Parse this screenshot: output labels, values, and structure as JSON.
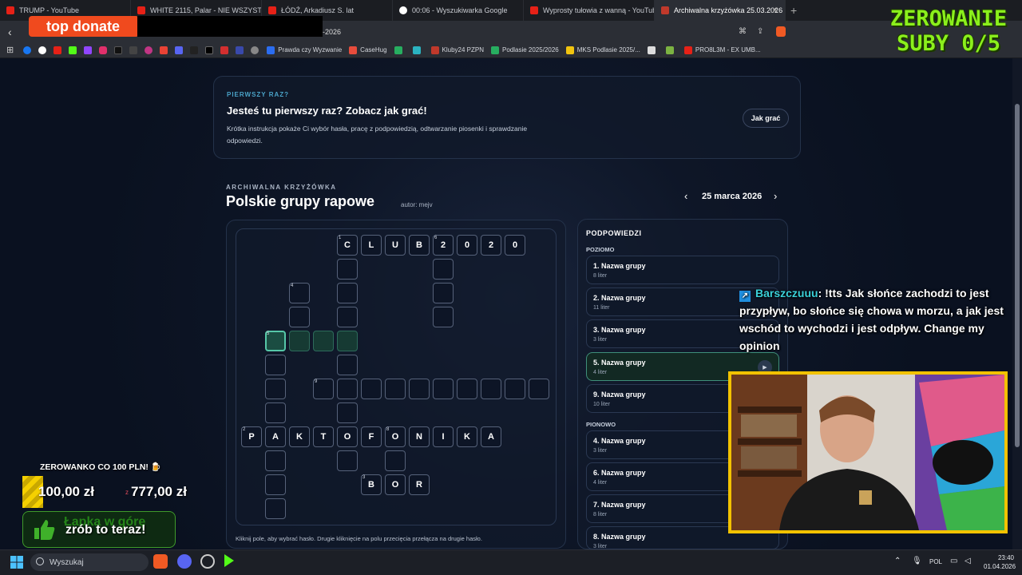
{
  "browser": {
    "tabs": [
      {
        "title": "TRUMP - YouTube",
        "color": "#e62117"
      },
      {
        "title": "WHITE 2115, Palar - NIE WSZYSTKO",
        "color": "#e62117"
      },
      {
        "title": "ŁÓDŹ, Arkadiusz S. lat",
        "color": "#e62117"
      },
      {
        "title": "00:06 - Wyszukiwarka Google",
        "color": "#4285f4"
      },
      {
        "title": "Wyprosty tułowia z wanną - YouTube",
        "color": "#e62117"
      },
      {
        "title": "Archiwalna krzyżówka 25.03.2026",
        "color": "#c0392b"
      }
    ],
    "address_tail": "-2026",
    "bookmarks": [
      "Prawda czy Wyzwanie",
      "CaseHug",
      "Kluby24 PZPN",
      "Podlasie 2025/2026",
      "MKS Podlasie 2025/...",
      "PRO8L3M - EX UMB..."
    ],
    "bookmark_colors": [
      "#2b6df0",
      "#e74c3c",
      "#27ae60",
      "#27ae60",
      "#f1c40f",
      "#e62117"
    ]
  },
  "overlays": {
    "top_donate": "top donate",
    "zerowanie_line1": "ZEROWANIE",
    "zerowanie_line2": "SUBY 0/5",
    "zerowanko": "ZEROWANKO CO 100 PLN! 🍺",
    "goal_current": "100,00 zł",
    "goal_sep": "z",
    "goal_max": "777,00 zł",
    "goal_progress": 0.129,
    "cta_line1": "Łapka w górę",
    "cta_line2": "zrób to teraz!"
  },
  "chat": {
    "user": "Barszczuuu",
    "message": ": !tts Jak słońce zachodzi to jest przypływ, bo słońce się chowa w morzu, a jak jest wschód to wychodzi i jest odpływ. Change my opinion"
  },
  "intro": {
    "kicker": "PIERWSZY RAZ?",
    "heading": "Jesteś tu pierwszy raz? Zobacz jak grać!",
    "text": "Krótka instrukcja pokaże Ci wybór hasła, pracę z podpowiedzią, odtwarzanie piosenki i sprawdzanie odpowiedzi.",
    "button": "Jak grać"
  },
  "puzzle": {
    "kicker": "ARCHIWALNA KRZYŻÓWKA",
    "title": "Polskie grupy rapowe",
    "author": "autor: mejv",
    "date": "25 marca 2026",
    "hint": "Kliknij pole, aby wybrać hasło. Drugie kliknięcie na polu przecięcia przełącza na drugie hasło."
  },
  "clues": {
    "heading": "PODPOWIEDZI",
    "across_label": "POZIOMO",
    "down_label": "PIONOWO",
    "across": [
      {
        "title": "1. Nazwa grupy",
        "sub": "8 liter"
      },
      {
        "title": "2. Nazwa grupy",
        "sub": "11 liter"
      },
      {
        "title": "3. Nazwa grupy",
        "sub": "3 liter"
      },
      {
        "title": "5. Nazwa grupy",
        "sub": "4 liter"
      },
      {
        "title": "9. Nazwa grupy",
        "sub": "10 liter"
      }
    ],
    "down": [
      {
        "title": "4. Nazwa grupy",
        "sub": "3 liter"
      },
      {
        "title": "6. Nazwa grupy",
        "sub": "4 liter"
      },
      {
        "title": "7. Nazwa grupy",
        "sub": "8 liter"
      },
      {
        "title": "8. Nazwa grupy",
        "sub": "3 liter"
      }
    ]
  },
  "taskbar": {
    "search": "Wyszukaj",
    "lang": "POL",
    "time": "23:40",
    "date": "01.04.2026"
  }
}
